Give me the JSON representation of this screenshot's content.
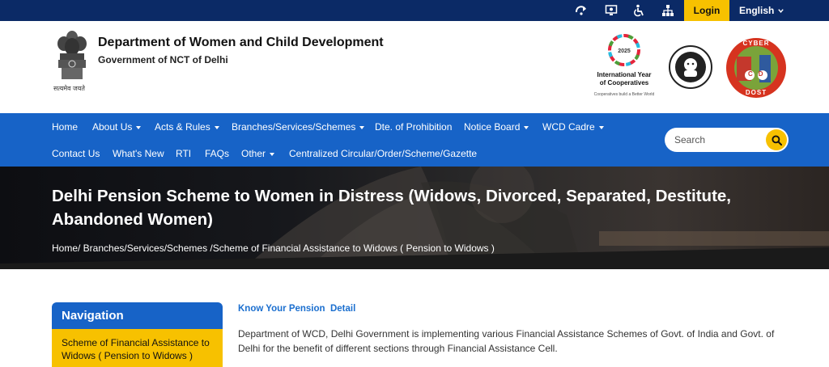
{
  "topbar": {
    "icons": [
      "skip-to-content-icon",
      "screen-reader-icon",
      "accessibility-icon",
      "sitemap-icon"
    ],
    "login_label": "Login",
    "language_label": "English"
  },
  "header": {
    "title": "Department of Women and Child Development",
    "subtitle": "Government of NCT of Delhi",
    "emblem_caption": "सत्यमेव जयते",
    "coop_logo": {
      "year": "2025",
      "title": "International Year of Cooperatives",
      "tagline": "Cooperatives build a Better World"
    },
    "cyber_logo": {
      "top_text": "CYBER",
      "bottom_text": "DOST",
      "letters": "CD"
    }
  },
  "nav": {
    "row1": [
      {
        "label": "Home",
        "dropdown": false
      },
      {
        "label": "About Us",
        "dropdown": true
      },
      {
        "label": "Acts & Rules",
        "dropdown": true
      },
      {
        "label": "Branches/Services/Schemes",
        "dropdown": true
      },
      {
        "label": "Dte. of Prohibition",
        "dropdown": false
      },
      {
        "label": "Notice Board",
        "dropdown": true
      },
      {
        "label": "WCD Cadre",
        "dropdown": true
      }
    ],
    "row2": [
      {
        "label": "Contact Us",
        "dropdown": false
      },
      {
        "label": "What's New",
        "dropdown": false
      },
      {
        "label": "RTI",
        "dropdown": false
      },
      {
        "label": "FAQs",
        "dropdown": false
      },
      {
        "label": "Other",
        "dropdown": true
      },
      {
        "label": "Centralized Circular/Order/Scheme/Gazette",
        "dropdown": false
      }
    ],
    "search_placeholder": "Search"
  },
  "banner": {
    "title": "Delhi Pension Scheme to Women in Distress (Widows, Divorced, Separated, Destitute, Abandoned Women)",
    "breadcrumb": "Home/ Branches/Services/Schemes /Scheme of Financial Assistance to Widows ( Pension to Widows )"
  },
  "sidebar": {
    "heading": "Navigation",
    "active_item": "Scheme of Financial Assistance to Widows ( Pension to Widows )"
  },
  "main": {
    "link_heading": "Know Your Pension  Detail",
    "paragraph": "Department of WCD, Delhi Government is implementing various Financial Assistance Schemes of Govt. of India and Govt. of Delhi for the benefit of different sections through Financial Assistance Cell."
  },
  "colors": {
    "topbar": "#0b2a66",
    "nav": "#1763c7",
    "accent": "#f7c100",
    "link": "#1b6fcf"
  }
}
